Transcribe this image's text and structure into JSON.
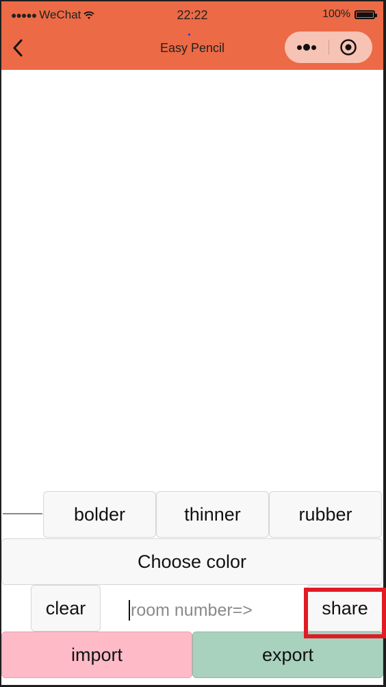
{
  "statusbar": {
    "carrier": "WeChat",
    "signal_dots": "●●●●●",
    "time": "22:22",
    "battery": "100%"
  },
  "navbar": {
    "title": "Easy Pencil",
    "back_icon": "chevron-left-icon",
    "more_icon": "more-dots-icon",
    "close_icon": "target-close-icon"
  },
  "tools": {
    "bolder": "bolder",
    "thinner": "thinner",
    "rubber": "rubber",
    "choose_color": "Choose color",
    "clear": "clear",
    "share": "share",
    "import": "import",
    "export": "export"
  },
  "room": {
    "placeholder": "room number=>"
  },
  "colors": {
    "navbar": "#ec6a45",
    "import_button": "#ffbac7",
    "export_button": "#a8d1be",
    "highlight": "#e01b24"
  }
}
